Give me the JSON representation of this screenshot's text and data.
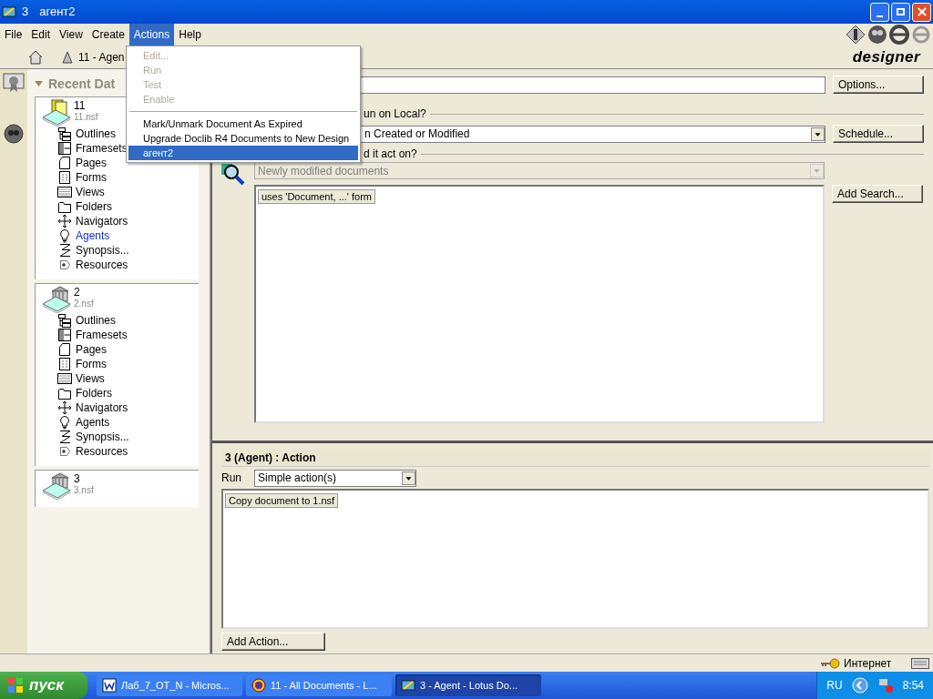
{
  "window": {
    "title_fragment": "3",
    "title": "агент2"
  },
  "menu_bar": [
    {
      "label": "File",
      "selected": false
    },
    {
      "label": "Edit",
      "selected": false
    },
    {
      "label": "View",
      "selected": false
    },
    {
      "label": "Create",
      "selected": false
    },
    {
      "label": "Actions",
      "selected": true
    },
    {
      "label": "Help",
      "selected": false
    }
  ],
  "actions_menu": [
    {
      "label": "Edit...",
      "disabled": true,
      "selected": false,
      "separator_before": false
    },
    {
      "label": "Run",
      "disabled": true,
      "selected": false,
      "separator_before": false
    },
    {
      "label": "Test",
      "disabled": true,
      "selected": false,
      "separator_before": false
    },
    {
      "label": "Enable",
      "disabled": true,
      "selected": false,
      "separator_before": false
    },
    {
      "label": "Mark/Unmark Document As Expired",
      "disabled": false,
      "selected": false,
      "separator_before": true
    },
    {
      "label": "Upgrade Doclib R4 Documents to New Design",
      "disabled": false,
      "selected": false,
      "separator_before": false
    },
    {
      "label": "агент2",
      "disabled": false,
      "selected": true,
      "separator_before": false
    }
  ],
  "brand": "designer",
  "tab": {
    "label": "11 - Agen"
  },
  "navigator": {
    "title": "Recent Dat",
    "databases": [
      {
        "name": "11",
        "file": "11.nsf",
        "kind": "stack",
        "items": [
          {
            "label": "Outlines",
            "kind": "outline",
            "selected": false
          },
          {
            "label": "Framesets",
            "kind": "frameset",
            "selected": false
          },
          {
            "label": "Pages",
            "kind": "page",
            "selected": false
          },
          {
            "label": "Forms",
            "kind": "form",
            "selected": false
          },
          {
            "label": "Views",
            "kind": "view",
            "selected": false
          },
          {
            "label": "Folders",
            "kind": "folder",
            "selected": false
          },
          {
            "label": "Navigators",
            "kind": "navigator",
            "selected": false
          },
          {
            "label": "Agents",
            "kind": "agent",
            "selected": true
          },
          {
            "label": "Synopsis...",
            "kind": "synopsis",
            "selected": false
          },
          {
            "label": "Resources",
            "kind": "resource",
            "selected": false
          }
        ]
      },
      {
        "name": "2",
        "file": "2.nsf",
        "kind": "library",
        "items": [
          {
            "label": "Outlines",
            "kind": "outline",
            "selected": false
          },
          {
            "label": "Framesets",
            "kind": "frameset",
            "selected": false
          },
          {
            "label": "Pages",
            "kind": "page",
            "selected": false
          },
          {
            "label": "Forms",
            "kind": "form",
            "selected": false
          },
          {
            "label": "Views",
            "kind": "view",
            "selected": false
          },
          {
            "label": "Folders",
            "kind": "folder",
            "selected": false
          },
          {
            "label": "Navigators",
            "kind": "navigator",
            "selected": false
          },
          {
            "label": "Agents",
            "kind": "agent",
            "selected": false
          },
          {
            "label": "Synopsis...",
            "kind": "synopsis",
            "selected": false
          },
          {
            "label": "Resources",
            "kind": "resource",
            "selected": false
          }
        ]
      },
      {
        "name": "3",
        "file": "3.nsf",
        "kind": "library"
      }
    ]
  },
  "agent": {
    "options_button": "Options...",
    "run_group": "un on Local?",
    "trigger": "n Created or Modified",
    "schedule_button": "Schedule...",
    "target_group": "d it act on?",
    "target": {
      "value": "Newly modified documents",
      "disabled": true
    },
    "search_item": "uses 'Document, ...' form",
    "add_search_button": "Add Search..."
  },
  "action_pane": {
    "title": "3 (Agent) : Action",
    "run_label": "Run",
    "run_value": "Simple action(s)",
    "actions": [
      "Copy document to 1.nsf"
    ],
    "add_action_button": "Add Action..."
  },
  "status_bar": {
    "zone": "Интернет"
  },
  "taskbar": {
    "start": "пуск",
    "tasks": [
      {
        "label": "Лаб_7_OT_N - Micros...",
        "kind": "word",
        "selected": false
      },
      {
        "label": "11 - All Documents - L...",
        "kind": "notes",
        "selected": false
      },
      {
        "label": "3 - Agent - Lotus Do...",
        "kind": "designer",
        "selected": true
      }
    ],
    "language": "RU",
    "time": "8:54"
  }
}
